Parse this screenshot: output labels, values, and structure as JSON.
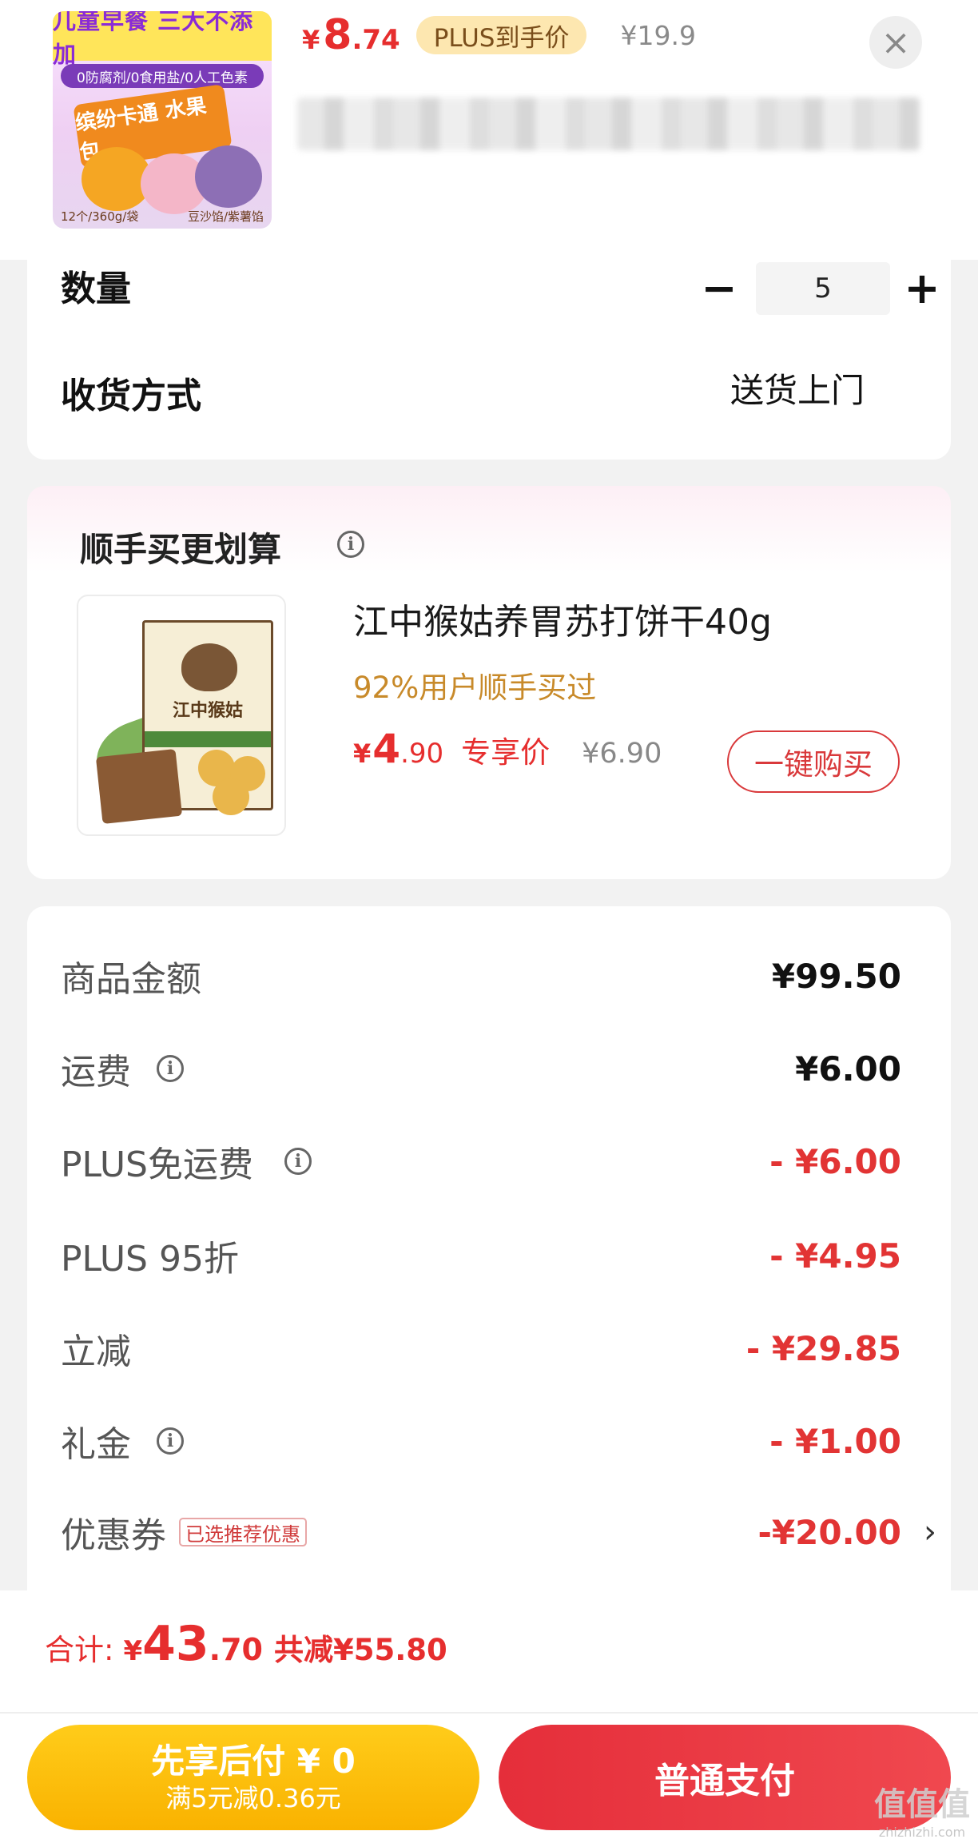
{
  "product": {
    "image_banner": "儿童早餐 三大不添加",
    "image_subbanner": "0防腐剂/0食用盐/0人工色素",
    "image_bag_text": "缤纷卡通 水果包",
    "image_footer_left": "12个/360g/袋",
    "image_footer_right": "豆沙馅/紫薯馅",
    "price_currency": "¥",
    "price_int": "8",
    "price_dec": ".74",
    "plus_label": "PLUS到手价",
    "original_price": "¥19.9",
    "close_symbol": "×"
  },
  "order": {
    "quantity_label": "数量",
    "quantity_minus": "−",
    "quantity_value": "5",
    "quantity_plus": "+",
    "delivery_label": "收货方式",
    "delivery_value": "送货上门"
  },
  "addon": {
    "title": "顺手买更划算",
    "info_symbol": "i",
    "product_name": "江中猴姑养胃苏打饼干40g",
    "social_proof": "92%用户顺手买过",
    "price_currency": "¥",
    "price_int": "4",
    "price_dec": ".90",
    "price_label": "专享价",
    "original_price": "¥6.90",
    "buy_button": "一键购买",
    "image_label": "江中猴姑"
  },
  "summary": {
    "rows": [
      {
        "label": "商品金额",
        "value": "¥99.50",
        "info": false
      },
      {
        "label": "运费",
        "value": "¥6.00",
        "info": true
      },
      {
        "label": "PLUS免运费",
        "value": "- ¥6.00",
        "info": true
      },
      {
        "label": "PLUS 95折",
        "value": "- ¥4.95",
        "info": false
      },
      {
        "label": "立减",
        "value": "- ¥29.85",
        "info": false
      },
      {
        "label": "礼金",
        "value": "- ¥1.00",
        "info": true
      },
      {
        "label": "优惠券",
        "value": "-¥20.00",
        "info": false,
        "tag": "已选推荐优惠"
      }
    ],
    "chevron": "›"
  },
  "footer": {
    "total_label": "合计:",
    "total_currency": "¥",
    "total_int": "43",
    "total_dec": ".70",
    "total_saved": "共减¥55.80",
    "pay_later_main": "先享后付 ¥ 0",
    "pay_later_sub": "满5元减0.36元",
    "pay_button": "普通支付"
  },
  "watermark": {
    "main": "值值值",
    "sub": "zhizhizhi.com"
  },
  "colors": {
    "accent_red": "#e62e2e",
    "plus_gold": "#fde7b0",
    "pay_later_yellow": "#f9b200",
    "social_gold": "#c88a2a"
  }
}
